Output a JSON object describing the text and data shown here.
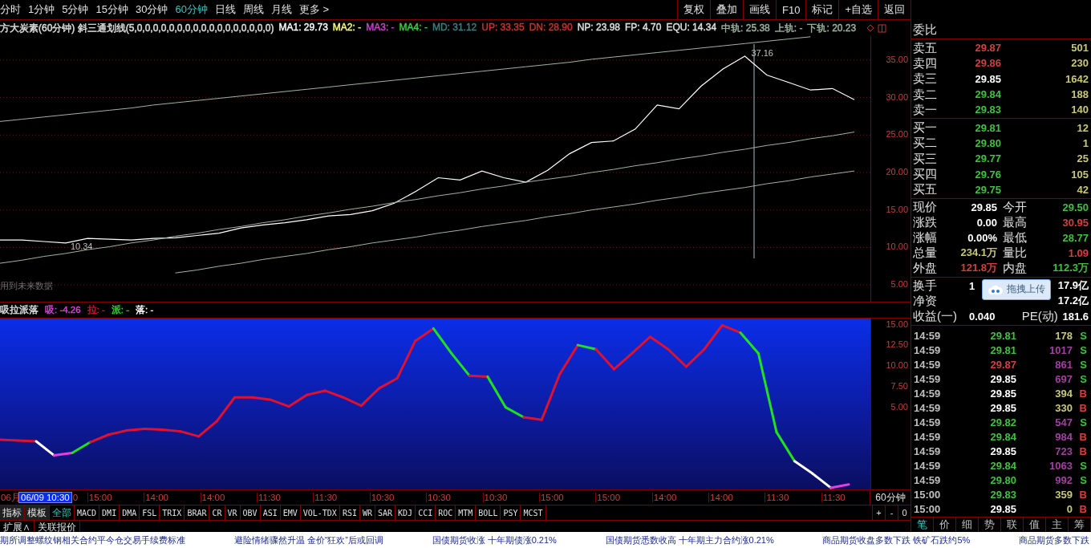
{
  "toolbar": {
    "periods": [
      {
        "label": "分时",
        "selected": false
      },
      {
        "label": "1分钟",
        "selected": false
      },
      {
        "label": "5分钟",
        "selected": false
      },
      {
        "label": "15分钟",
        "selected": false
      },
      {
        "label": "30分钟",
        "selected": false
      },
      {
        "label": "60分钟",
        "selected": true
      },
      {
        "label": "日线",
        "selected": false
      },
      {
        "label": "周线",
        "selected": false
      },
      {
        "label": "月线",
        "selected": false
      },
      {
        "label": "更多 >",
        "selected": false
      }
    ],
    "buttons": [
      "复权",
      "叠加",
      "画线",
      "F10",
      "标记",
      "+自选",
      "返回"
    ]
  },
  "main_chart": {
    "title": "方大炭素(60分钟) 斜三通划线(5,0,0,0,0,0,0,0,0,0,0,0,0,0,0,0,0,0)",
    "legend": [
      {
        "text": "MA1: 29.73",
        "color": "#ffffff"
      },
      {
        "text": "MA2: -",
        "color": "#ffff80"
      },
      {
        "text": "MA3: -",
        "color": "#d040d0"
      },
      {
        "text": "MA4: -",
        "color": "#40d040"
      },
      {
        "text": "MD: 31.12",
        "color": "#3f7f7f"
      },
      {
        "text": "UP: 33.35",
        "color": "#d03030"
      },
      {
        "text": "DN: 28.90",
        "color": "#d03030"
      },
      {
        "text": "NP: 23.98",
        "color": "#e0e0e0"
      },
      {
        "text": "FP: 4.70",
        "color": "#e0e0e0"
      },
      {
        "text": "EQU: 14.34",
        "color": "#e0e0e0"
      },
      {
        "text": "中轨: 25.38",
        "color": "#a0b4a0"
      },
      {
        "text": "上轨: -",
        "color": "#a0b4a0"
      },
      {
        "text": "下轨: 20.23",
        "color": "#a0b4a0"
      }
    ],
    "high_label": "37.16",
    "low_label": "10.34",
    "note": "用到未来数据",
    "chart_data": {
      "type": "line",
      "grid": true,
      "ylim": [
        2.77,
        38.19
      ],
      "yticks": [
        {
          "value": 5,
          "label": "5.00"
        },
        {
          "value": 10,
          "label": "10.00"
        },
        {
          "value": 15,
          "label": "15.00"
        },
        {
          "value": 20,
          "label": "20.00"
        },
        {
          "value": 25,
          "label": "25.00"
        },
        {
          "value": 30,
          "label": "30.00"
        },
        {
          "value": 35,
          "label": "35.00"
        }
      ],
      "series": [
        {
          "color": "#ffffff",
          "values": [
            11.0,
            11.0,
            10.8,
            10.6,
            11.2,
            11.1,
            11.0,
            11.2,
            11.3,
            11.6,
            11.9,
            12.6,
            13.0,
            13.3,
            13.7,
            14.2,
            14.4,
            14.9,
            15.9,
            17.5,
            19.3,
            19.0,
            20.2,
            19.3,
            18.7,
            20.3,
            22.5,
            24.0,
            24.2,
            25.8,
            29.0,
            28.5,
            31.5,
            33.8,
            35.5,
            33.0,
            32.0,
            31.0,
            31.2,
            29.7
          ]
        },
        {
          "color": "#a0b4a0",
          "values": [
            26.8,
            27.1,
            27.4,
            27.7,
            28.0,
            28.3,
            28.6,
            29.0,
            29.3,
            29.6,
            29.9,
            30.2,
            30.5,
            30.8,
            31.1,
            31.4,
            31.7,
            32.0,
            32.3,
            32.6,
            32.9,
            33.2,
            33.5,
            33.8,
            34.1,
            34.4,
            34.7,
            35.1,
            35.4,
            35.7,
            36.0,
            36.3,
            36.6,
            36.9,
            37.2,
            37.5,
            37.8,
            38.1,
            null,
            null
          ]
        },
        {
          "color": "#a0b4a0",
          "values": [
            7.9,
            8.3,
            8.8,
            9.2,
            9.7,
            10.1,
            10.6,
            11.0,
            11.5,
            11.9,
            12.4,
            12.8,
            13.3,
            13.7,
            14.2,
            14.6,
            15.1,
            15.5,
            16.0,
            16.4,
            16.9,
            17.3,
            17.8,
            18.2,
            18.7,
            19.1,
            19.5,
            20.0,
            20.4,
            20.9,
            21.3,
            21.8,
            22.2,
            22.7,
            23.1,
            23.6,
            24.0,
            24.5,
            24.9,
            25.4
          ]
        },
        {
          "color": "#a0b4a0",
          "values": [
            null,
            null,
            null,
            null,
            null,
            null,
            null,
            null,
            6.6,
            7.0,
            7.5,
            7.9,
            8.4,
            8.8,
            9.2,
            9.7,
            10.1,
            10.6,
            11.0,
            11.4,
            11.9,
            12.3,
            12.8,
            13.2,
            13.6,
            14.1,
            14.5,
            15.0,
            15.4,
            15.8,
            16.3,
            16.7,
            17.2,
            17.6,
            18.0,
            18.5,
            18.9,
            19.4,
            19.8,
            20.2
          ]
        }
      ]
    }
  },
  "lower_chart": {
    "title": "吸拉派落",
    "legend": [
      {
        "text": "吸: -4.26",
        "color": "#e040e0"
      },
      {
        "text": "拉: -",
        "color": "#e01030"
      },
      {
        "text": "派: -",
        "color": "#20e020"
      },
      {
        "text": "落: -",
        "color": "#ffffff"
      }
    ],
    "y_labels": [
      "15.00",
      "12.50",
      "10.00",
      "7.50",
      "5.00"
    ]
  },
  "time_axis": [
    {
      "label": "06月",
      "kind": "tick"
    },
    {
      "label": "06/09 10:30",
      "kind": "cursor"
    },
    {
      "label": "0",
      "kind": "tick"
    },
    {
      "label": "15:00",
      "kind": "tick"
    },
    {
      "label": "14:00",
      "kind": "tick"
    },
    {
      "label": "14:00",
      "kind": "tick"
    },
    {
      "label": "11:30",
      "kind": "tick"
    },
    {
      "label": "11:30",
      "kind": "tick"
    },
    {
      "label": "10:30",
      "kind": "tick"
    },
    {
      "label": "10:30",
      "kind": "tick"
    },
    {
      "label": "10:30",
      "kind": "tick"
    },
    {
      "label": "15:00",
      "kind": "tick"
    },
    {
      "label": "15:00",
      "kind": "tick"
    },
    {
      "label": "14:00",
      "kind": "tick"
    },
    {
      "label": "14:00",
      "kind": "tick"
    },
    {
      "label": "11:30",
      "kind": "tick"
    },
    {
      "label": "11:30",
      "kind": "tick"
    }
  ],
  "period_label": "60分钟",
  "indicator_tabs": [
    {
      "label": "指标",
      "selected": false
    },
    {
      "label": "模板",
      "selected": false
    },
    {
      "label": "全部",
      "selected": true
    },
    {
      "label": "MACD",
      "selected": false
    },
    {
      "label": "DMI",
      "selected": false
    },
    {
      "label": "DMA",
      "selected": false
    },
    {
      "label": "FSL",
      "selected": false
    },
    {
      "label": "TRIX",
      "selected": false
    },
    {
      "label": "BRAR",
      "selected": false
    },
    {
      "label": "CR",
      "selected": false
    },
    {
      "label": "VR",
      "selected": false
    },
    {
      "label": "OBV",
      "selected": false
    },
    {
      "label": "ASI",
      "selected": false
    },
    {
      "label": "EMV",
      "selected": false
    },
    {
      "label": "VOL-TDX",
      "selected": false
    },
    {
      "label": "RSI",
      "selected": false
    },
    {
      "label": "WR",
      "selected": false
    },
    {
      "label": "SAR",
      "selected": false
    },
    {
      "label": "KDJ",
      "selected": false
    },
    {
      "label": "CCI",
      "selected": false
    },
    {
      "label": "ROC",
      "selected": false
    },
    {
      "label": "MTM",
      "selected": false
    },
    {
      "label": "BOLL",
      "selected": false
    },
    {
      "label": "PSY",
      "selected": false
    },
    {
      "label": "MCST",
      "selected": false
    }
  ],
  "zoom_buttons": [
    "+",
    "-",
    "0"
  ],
  "extra_tabs": [
    "扩展∧",
    "关联报价"
  ],
  "news": [
    "期所调整螺纹钢相关合约平今仓交易手续费标准",
    "避险情绪骤然升温 金价“狂欢”后或回调",
    "国债期货收涨 十年期债涨0.21%",
    "国债期货悉数收高 十年期主力合约涨0.21%",
    "商品期货收盘多数下跌 铁矿石跌约5%",
    "商品期货多数下跌"
  ],
  "quote": {
    "ratio_label": "委比",
    "asks": [
      {
        "label": "卖五",
        "price": "29.87",
        "color": "#d04040",
        "volume": "501"
      },
      {
        "label": "卖四",
        "price": "29.86",
        "color": "#d04040",
        "volume": "230"
      },
      {
        "label": "卖三",
        "price": "29.85",
        "color": "#ffffff",
        "volume": "1642"
      },
      {
        "label": "卖二",
        "price": "29.84",
        "color": "#40c040",
        "volume": "188"
      },
      {
        "label": "卖一",
        "price": "29.83",
        "color": "#40c040",
        "volume": "140"
      }
    ],
    "bids": [
      {
        "label": "买一",
        "price": "29.81",
        "color": "#40c040",
        "volume": "12"
      },
      {
        "label": "买二",
        "price": "29.80",
        "color": "#40c040",
        "volume": "1"
      },
      {
        "label": "买三",
        "price": "29.77",
        "color": "#40c040",
        "volume": "25"
      },
      {
        "label": "买四",
        "price": "29.76",
        "color": "#40c040",
        "volume": "105"
      },
      {
        "label": "买五",
        "price": "29.75",
        "color": "#40c040",
        "volume": "42"
      }
    ],
    "stats": [
      {
        "label": "现价",
        "value": "29.85",
        "color": "#ffffff"
      },
      {
        "label": "今开",
        "value": "29.50",
        "color": "#40c040"
      },
      {
        "label": "涨跌",
        "value": "0.00",
        "color": "#ffffff"
      },
      {
        "label": "最高",
        "value": "30.95",
        "color": "#d04040"
      },
      {
        "label": "涨幅",
        "value": "0.00%",
        "color": "#ffffff"
      },
      {
        "label": "最低",
        "value": "28.77",
        "color": "#40c040"
      },
      {
        "label": "总量",
        "value": "234.1万",
        "color": "#c8c878"
      },
      {
        "label": "量比",
        "value": "1.09",
        "color": "#d04040"
      },
      {
        "label": "外盘",
        "value": "121.8万",
        "color": "#d04040"
      },
      {
        "label": "内盘",
        "value": "112.3万",
        "color": "#40c040"
      }
    ],
    "stats2": [
      {
        "label": "换手",
        "value": "1",
        "color": "#ffffff"
      },
      {
        "value": "17.9亿",
        "color": "#ffffff"
      },
      {
        "label": "净资"
      },
      {
        "value": "17.2亿",
        "color": "#ffffff"
      },
      {
        "label": "收益(一)",
        "value": "0.040",
        "color": "#ffffff"
      },
      {
        "label": "PE(动)",
        "value": "181.6",
        "color": "#ffffff"
      }
    ],
    "upload_button": "拖拽上传"
  },
  "trades": [
    {
      "time": "14:59",
      "price": {
        "text": "29.81",
        "color": "#40c040"
      },
      "volume": {
        "text": "178",
        "color": "#c8c878"
      },
      "side": {
        "text": "S",
        "color": "#40c040"
      }
    },
    {
      "time": "14:59",
      "price": {
        "text": "29.81",
        "color": "#40c040"
      },
      "volume": {
        "text": "1017",
        "color": "#a040a0"
      },
      "side": {
        "text": "S",
        "color": "#40c040"
      }
    },
    {
      "time": "14:59",
      "price": {
        "text": "29.87",
        "color": "#d04040"
      },
      "volume": {
        "text": "861",
        "color": "#a040a0"
      },
      "side": {
        "text": "S",
        "color": "#40c040"
      }
    },
    {
      "time": "14:59",
      "price": {
        "text": "29.85",
        "color": "#ffffff"
      },
      "volume": {
        "text": "697",
        "color": "#a040a0"
      },
      "side": {
        "text": "S",
        "color": "#40c040"
      }
    },
    {
      "time": "14:59",
      "price": {
        "text": "29.85",
        "color": "#ffffff"
      },
      "volume": {
        "text": "394",
        "color": "#c8c878"
      },
      "side": {
        "text": "B",
        "color": "#d04040"
      }
    },
    {
      "time": "14:59",
      "price": {
        "text": "29.85",
        "color": "#ffffff"
      },
      "volume": {
        "text": "330",
        "color": "#c8c878"
      },
      "side": {
        "text": "B",
        "color": "#d04040"
      }
    },
    {
      "time": "14:59",
      "price": {
        "text": "29.82",
        "color": "#40c040"
      },
      "volume": {
        "text": "547",
        "color": "#a040a0"
      },
      "side": {
        "text": "S",
        "color": "#40c040"
      }
    },
    {
      "time": "14:59",
      "price": {
        "text": "29.84",
        "color": "#40c040"
      },
      "volume": {
        "text": "984",
        "color": "#a040a0"
      },
      "side": {
        "text": "B",
        "color": "#d04040"
      }
    },
    {
      "time": "14:59",
      "price": {
        "text": "29.85",
        "color": "#ffffff"
      },
      "volume": {
        "text": "723",
        "color": "#a040a0"
      },
      "side": {
        "text": "B",
        "color": "#d04040"
      }
    },
    {
      "time": "14:59",
      "price": {
        "text": "29.84",
        "color": "#40c040"
      },
      "volume": {
        "text": "1063",
        "color": "#a040a0"
      },
      "side": {
        "text": "S",
        "color": "#40c040"
      }
    },
    {
      "time": "14:59",
      "price": {
        "text": "29.80",
        "color": "#40c040"
      },
      "volume": {
        "text": "992",
        "color": "#a040a0"
      },
      "side": {
        "text": "S",
        "color": "#40c040"
      }
    },
    {
      "time": "15:00",
      "price": {
        "text": "29.83",
        "color": "#40c040"
      },
      "volume": {
        "text": "359",
        "color": "#c8c878"
      },
      "side": {
        "text": "B",
        "color": "#d04040"
      }
    },
    {
      "time": "15:00",
      "price": {
        "text": "29.85",
        "color": "#ffffff"
      },
      "volume": {
        "text": "0",
        "color": "#c8c878"
      },
      "side": {
        "text": "B",
        "color": "#d04040"
      }
    }
  ],
  "panel_tabs": [
    {
      "label": "笔",
      "selected": true
    },
    {
      "label": "价",
      "selected": false
    },
    {
      "label": "细",
      "selected": false
    },
    {
      "label": "势",
      "selected": false
    },
    {
      "label": "联",
      "selected": false
    },
    {
      "label": "值",
      "selected": false
    },
    {
      "label": "主",
      "selected": false
    },
    {
      "label": "筹",
      "selected": false
    }
  ]
}
